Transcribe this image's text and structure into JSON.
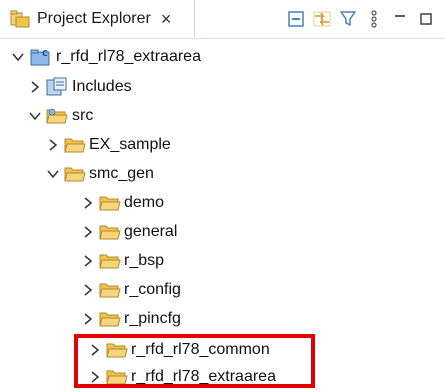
{
  "tab": {
    "title": "Project Explorer",
    "close": "×"
  },
  "toolbar": {
    "menu_glyph": "⋮"
  },
  "tree": {
    "root": {
      "label": "r_rfd_rl78_extraarea"
    },
    "includes": {
      "label": "Includes"
    },
    "src": {
      "label": "src"
    },
    "ex_sample": {
      "label": "EX_sample"
    },
    "smc_gen": {
      "label": "smc_gen"
    },
    "demo": {
      "label": "demo"
    },
    "general": {
      "label": "general"
    },
    "r_bsp": {
      "label": "r_bsp"
    },
    "r_config": {
      "label": "r_config"
    },
    "r_pincfg": {
      "label": "r_pincfg"
    },
    "r_rfd_rl78_common": {
      "label": "r_rfd_rl78_common"
    },
    "r_rfd_rl78_extraarea": {
      "label": "r_rfd_rl78_extraarea"
    }
  },
  "colors": {
    "highlight": "#e30000",
    "folder": "#f2c24a",
    "project": "#4a8fd6"
  }
}
